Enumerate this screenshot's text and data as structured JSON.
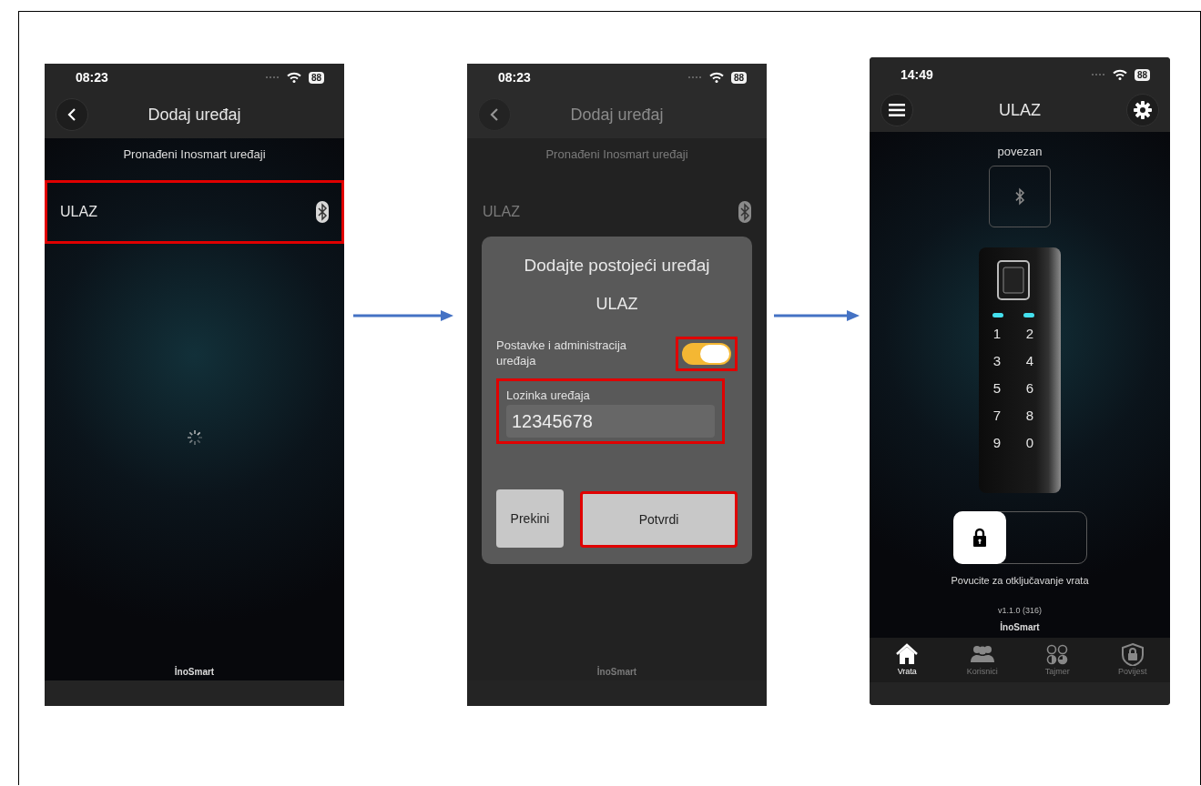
{
  "screens": [
    {
      "kind": "device_list",
      "dimmed": false,
      "status_bar": {
        "time": "08:23",
        "battery": "88"
      },
      "header": {
        "title": "Dodaj uređaj"
      },
      "subtitle": "Pronađeni Inosmart uređaji",
      "devices": [
        {
          "name": "ULAZ",
          "highlighted": true
        }
      ],
      "loading": true,
      "brand": "İnoSmart"
    },
    {
      "kind": "device_list",
      "dimmed": true,
      "status_bar": {
        "time": "08:23",
        "battery": "88"
      },
      "header": {
        "title": "Dodaj uređaj"
      },
      "subtitle": "Pronađeni Inosmart uređaji",
      "devices": [
        {
          "name": "ULAZ",
          "highlighted": false
        }
      ],
      "loading": false,
      "brand": "İnoSmart",
      "dialog": {
        "title": "Dodajte postojeći uređaj",
        "device": "ULAZ",
        "toggle": {
          "label": "Postavke i administracija uređaja",
          "on": true,
          "highlighted": true
        },
        "password": {
          "label": "Lozinka uređaja",
          "value": "12345678",
          "highlighted": true
        },
        "buttons": [
          {
            "label": "Prekini",
            "highlighted": false
          },
          {
            "label": "Potvrdi",
            "highlighted": true
          }
        ]
      }
    },
    {
      "kind": "door",
      "status_bar": {
        "time": "14:49",
        "battery": "88"
      },
      "header": {
        "title": "ULAZ"
      },
      "connection": "povezan",
      "keypad": [
        "1",
        "2",
        "3",
        "4",
        "5",
        "6",
        "7",
        "8",
        "9",
        "0"
      ],
      "unlock_slider": {
        "level": 0,
        "hint": "Povucite za otključavanje vrata"
      },
      "version": "v1.1.0 (316)",
      "brand": "İnoSmart",
      "nav": [
        {
          "label": "Vrata",
          "selected": true
        },
        {
          "label": "Korisnici",
          "selected": false
        },
        {
          "label": "Tajmer",
          "selected": false
        },
        {
          "label": "Povijest",
          "selected": false
        }
      ]
    }
  ]
}
